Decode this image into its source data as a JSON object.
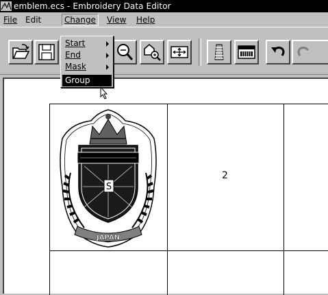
{
  "window": {
    "title": "emblem.ecs - Embroidery Data Editor",
    "app_icon": "embroidery-app-icon"
  },
  "menubar": {
    "items": [
      {
        "label": "File"
      },
      {
        "label": "Edit"
      },
      {
        "label": "Change"
      },
      {
        "label": "View"
      },
      {
        "label": "Help"
      }
    ]
  },
  "change_menu": {
    "items": [
      {
        "label": "Start",
        "has_submenu": true
      },
      {
        "label": "End",
        "has_submenu": true
      },
      {
        "label": "Mask",
        "has_submenu": true
      },
      {
        "label": "Group",
        "has_submenu": false,
        "selected": true
      }
    ]
  },
  "toolbar": {
    "buttons": [
      "open-folder-icon",
      "save-icon",
      "zoom-out-icon",
      "zoom-in-area-icon",
      "fit-to-window-icon",
      "thread-spool-icon",
      "color-bar-icon",
      "undo-icon",
      "redo-icon"
    ]
  },
  "grid": {
    "cells": [
      {
        "content": "embroidery emblem design"
      },
      {
        "label": "2"
      }
    ]
  },
  "emblem": {
    "center_letter": "S",
    "banner_text": "JAPAN"
  }
}
